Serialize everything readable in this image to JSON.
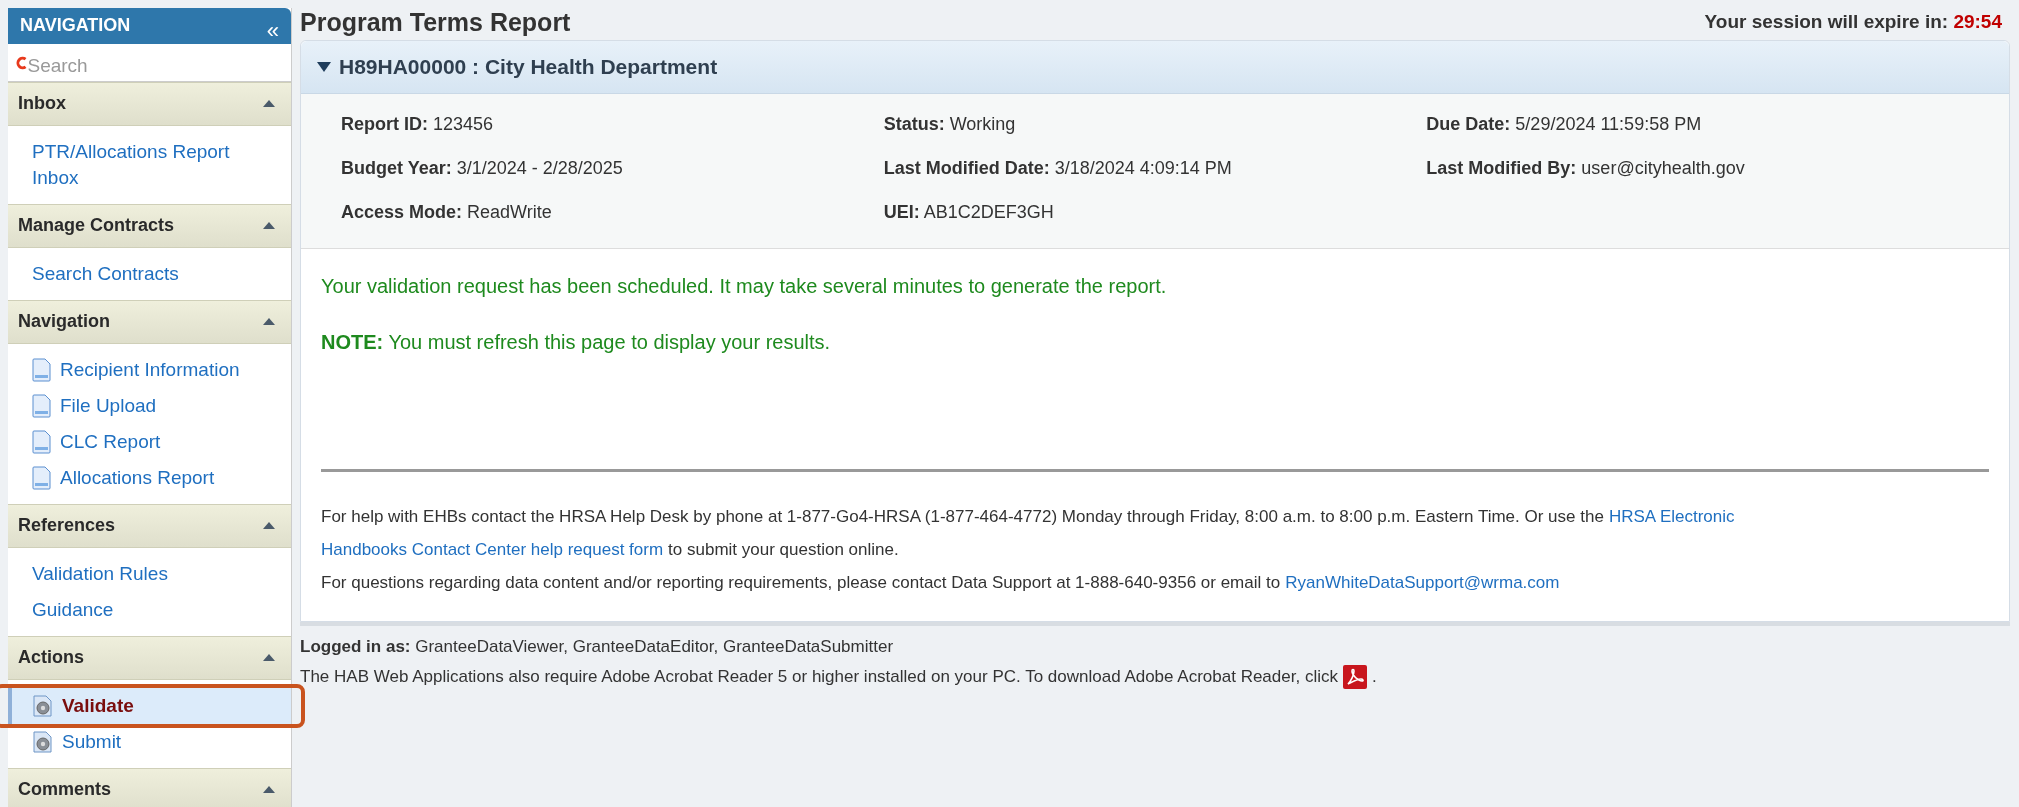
{
  "sidebar": {
    "title": "NAVIGATION",
    "collapse": "«",
    "search": {
      "placeholder": "Search"
    },
    "sections": [
      {
        "title": "Inbox",
        "expanded": true,
        "items": [
          {
            "label": "PTR/Allocations Report Inbox",
            "kind": "link",
            "selected": false
          }
        ]
      },
      {
        "title": "Manage Contracts",
        "expanded": true,
        "items": [
          {
            "label": "Search Contracts",
            "kind": "link",
            "selected": false
          }
        ]
      },
      {
        "title": "Navigation",
        "expanded": true,
        "items": [
          {
            "label": "Recipient Information",
            "kind": "page",
            "selected": false
          },
          {
            "label": "File Upload",
            "kind": "page",
            "selected": false
          },
          {
            "label": "CLC Report",
            "kind": "page",
            "selected": false
          },
          {
            "label": "Allocations Report",
            "kind": "page",
            "selected": false
          }
        ]
      },
      {
        "title": "References",
        "expanded": true,
        "items": [
          {
            "label": "Validation Rules",
            "kind": "link",
            "selected": false
          },
          {
            "label": "Guidance",
            "kind": "link",
            "selected": false
          }
        ]
      },
      {
        "title": "Actions",
        "expanded": true,
        "items": [
          {
            "label": "Validate",
            "kind": "action",
            "selected": true,
            "highlighted": true
          },
          {
            "label": "Submit",
            "kind": "action",
            "selected": false,
            "highlighted": false
          }
        ]
      },
      {
        "title": "Comments",
        "expanded": true
      }
    ]
  },
  "page_title": "Program Terms Report",
  "session": {
    "label": "Your session will expire in:",
    "time": "29:54"
  },
  "panel": {
    "title": "H89HA00000 : City Health Department",
    "expanded": true,
    "fields": [
      [
        {
          "label": "Report ID:",
          "value": "123456"
        },
        {
          "label": "Budget Year:",
          "value": "3/1/2024 - 2/28/2025"
        },
        {
          "label": "Access Mode:",
          "value": "ReadWrite"
        }
      ],
      [
        {
          "label": "Status:",
          "value": "Working"
        },
        {
          "label": "Last Modified Date:",
          "value": "3/18/2024 4:09:14 PM"
        },
        {
          "label": "UEI:",
          "value": "AB1C2DEF3GH"
        }
      ],
      [
        {
          "label": "Due Date:",
          "value": "5/29/2024 11:59:58 PM"
        },
        {
          "label": "Last Modified By:",
          "value": "user@cityhealth.gov"
        }
      ]
    ],
    "messages": [
      "Your validation request has been scheduled. It may take several minutes to generate the report.",
      "**NOTE:** You must refresh this page to display your results."
    ],
    "help_lines": [
      [
        {
          "kind": "text",
          "text": "For help with EHBs contact the HRSA Help Desk by phone at 1-877-Go4-HRSA (1-877-464-4772) Monday through Friday, 8:00 a.m. to 8:00 p.m. Eastern Time. Or use the"
        },
        {
          "kind": "link",
          "text": "HRSA Electronic"
        }
      ],
      [
        {
          "kind": "link",
          "text": "Handbooks Contact Center help request form"
        },
        {
          "kind": "text",
          "text": "to submit your question online."
        }
      ],
      [
        {
          "kind": "text",
          "text": "For questions regarding data content and/or reporting requirements, please contact Data Support at 1-888-640-9356 or email to"
        },
        {
          "kind": "link",
          "text": "RyanWhiteDataSupport@wrma.com"
        }
      ]
    ]
  },
  "footer": {
    "logged_in": "**Logged in as:** GranteeDataViewer, GranteeDataEditor, GranteeDataSubmitter",
    "adobe": "The HAB Web Applications also require Adobe Acrobat Reader 5 or higher installed on your PC. To download Adobe Acrobat Reader, click",
    "adobe_end": "."
  }
}
